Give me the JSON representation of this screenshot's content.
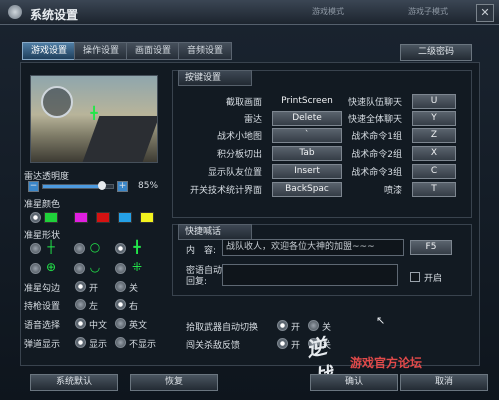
{
  "window": {
    "title": "系统设置",
    "background_tabs": [
      "游戏模式",
      "游戏子模式"
    ]
  },
  "tabs": [
    {
      "label": "游戏设置",
      "active": true
    },
    {
      "label": "操作设置",
      "active": false
    },
    {
      "label": "画面设置",
      "active": false
    },
    {
      "label": "音频设置",
      "active": false
    }
  ],
  "secondary_password_label": "二级密码",
  "left": {
    "radar_opacity_label": "雷达透明度",
    "radar_opacity_value": "85%",
    "radar_opacity_fraction": 0.85,
    "crosshair_color_label": "准星颜色",
    "crosshair_colors": [
      "#1fd13a",
      "#e01fe0",
      "#d51212",
      "#25a0e6",
      "#f3f31e"
    ],
    "crosshair_shape_label": "准星形状",
    "crosshair_edge_label": "准星勾边",
    "crosshair_edge_on": "开",
    "crosshair_edge_off": "关",
    "grip_label": "持枪设置",
    "grip_left": "左",
    "grip_right": "右",
    "language_label": "语音选择",
    "language_cn": "中文",
    "language_en": "英文",
    "ballistic_label": "弹道显示",
    "ballistic_show": "显示",
    "ballistic_hide": "不显示"
  },
  "keys": {
    "section_title": "按键设置",
    "left_col": [
      {
        "label": "截取画面",
        "key": "PrintScreen",
        "plain": true
      },
      {
        "label": "雷达",
        "key": "Delete"
      },
      {
        "label": "战术小地图",
        "key": "`"
      },
      {
        "label": "积分板切出",
        "key": "Tab"
      },
      {
        "label": "显示队友位置",
        "key": "Insert"
      },
      {
        "label": "开关技术统计界面",
        "key": "BackSpac"
      }
    ],
    "right_col": [
      {
        "label": "快速队伍聊天",
        "key": "U"
      },
      {
        "label": "快速全体聊天",
        "key": "Y"
      },
      {
        "label": "战术命令1组",
        "key": "Z"
      },
      {
        "label": "战术命令2组",
        "key": "X"
      },
      {
        "label": "战术命令3组",
        "key": "C"
      },
      {
        "label": "喷漆",
        "key": "T"
      }
    ]
  },
  "quick_chat": {
    "section_title": "快捷喊话",
    "content_label": "内　容:",
    "content_value": "战队收人，欢迎各位大神的加盟~~~",
    "key": "F5",
    "auto_reply_label": "密语自动回复:",
    "enable_label": "开启"
  },
  "bottom_options": {
    "weapon_auto_switch_label": "拾取武器自动切换",
    "on": "开",
    "off": "关",
    "intrusion_label": "闯关杀敌反馈"
  },
  "footer": {
    "default_label": "系统默认",
    "restore_label": "恢复",
    "confirm_label": "确认",
    "cancel_label": "取消"
  },
  "watermark": "游戏官方论坛"
}
